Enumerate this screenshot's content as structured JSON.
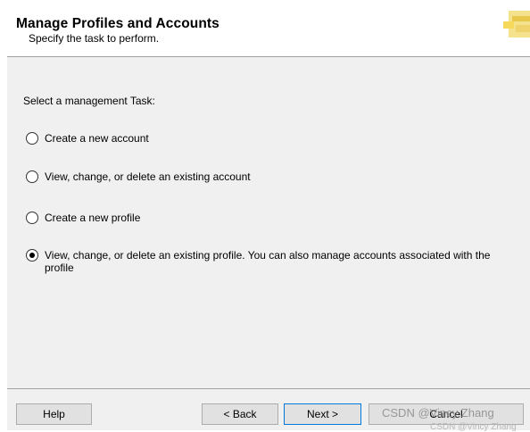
{
  "header": {
    "title": "Manage Profiles and Accounts",
    "subtitle": "Specify the task to perform."
  },
  "content": {
    "prompt": "Select a management Task:",
    "options": [
      {
        "label": "Create a new account",
        "selected": false
      },
      {
        "label": "View, change, or delete an existing account",
        "selected": false
      },
      {
        "label": "Create a new profile",
        "selected": false
      },
      {
        "label": "View, change, or delete an existing profile. You can also manage accounts associated with the profile",
        "selected": true
      }
    ]
  },
  "footer": {
    "help_label": "Help",
    "back_label": "< Back",
    "next_label": "Next >",
    "cancel_label": "Cancel"
  },
  "watermark": {
    "text": "CSDN @Vincy Zhang",
    "text_small": "CSDN @Vincy Zhang"
  },
  "colors": {
    "dialog_background": "#f0f0f0",
    "header_background": "#ffffff",
    "default_button_border": "#0078d7"
  }
}
